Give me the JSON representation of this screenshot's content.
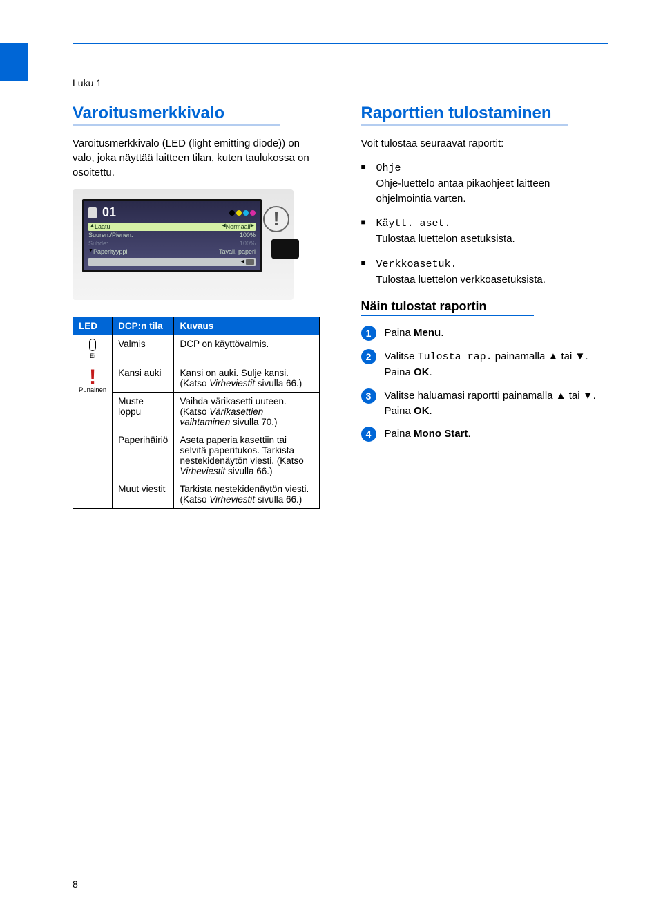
{
  "chapter_label": "Luku 1",
  "page_number": "8",
  "left": {
    "heading": "Varoitusmerkkivalo",
    "intro": "Varoitusmerkkivalo (LED (light emitting diode)) on valo, joka näyttää laitteen tilan, kuten taulukossa on osoitettu.",
    "lcd": {
      "num": "01",
      "rows": [
        {
          "l": "Laatu",
          "r": "Normaali"
        },
        {
          "l": "Suuren./Pienen.",
          "r": "100%"
        },
        {
          "l": "Suhde:",
          "r": "100%"
        },
        {
          "l": "Paperityyppi",
          "r": "Tavall. paperi"
        }
      ]
    },
    "table": {
      "headers": [
        "LED",
        "DCP:n tila",
        "Kuvaus"
      ],
      "led_off_caption": "Ei",
      "led_on_caption": "Punainen",
      "rows": [
        {
          "state": "Valmis",
          "desc": "DCP on käyttövalmis."
        },
        {
          "state": "Kansi auki",
          "desc_pre": "Kansi on auki. Sulje kansi. (Katso ",
          "desc_it": "Virheviestit",
          "desc_post": " sivulla 66.)"
        },
        {
          "state": "Muste loppu",
          "desc_pre": "Vaihda värikasetti uuteen.\n(Katso ",
          "desc_it": "Värikasettien vaihtaminen",
          "desc_post": " sivulla 70.)"
        },
        {
          "state": "Paperihäiriö",
          "desc_pre": "Aseta paperia kasettiin tai selvitä paperitukos. Tarkista nestekidenäytön viesti. (Katso ",
          "desc_it": "Virheviestit",
          "desc_post": " sivulla 66.)"
        },
        {
          "state": "Muut viestit",
          "desc_pre": "Tarkista nestekidenäytön viesti. (Katso ",
          "desc_it": "Virheviestit",
          "desc_post": " sivulla 66.)"
        }
      ]
    }
  },
  "right": {
    "heading": "Raporttien tulostaminen",
    "intro": "Voit tulostaa seuraavat raportit:",
    "bullets": [
      {
        "mono": "Ohje",
        "plain": "Ohje-luettelo antaa pikaohjeet laitteen ohjelmointia varten."
      },
      {
        "mono": "Käytt. aset.",
        "plain": "Tulostaa luettelon asetuksista."
      },
      {
        "mono": "Verkkoasetuk.",
        "plain": "Tulostaa luettelon verkkoasetuksista."
      }
    ],
    "sub_heading": "Näin tulostat raportin",
    "steps": {
      "s1_pre": "Paina ",
      "s1_b": "Menu",
      "s2_pre": "Valitse ",
      "s2_mono": "Tulosta rap.",
      "s2_mid": " painamalla ",
      "s2_arrows": "▲ tai ▼",
      "s2_post": ".",
      "s2_line2_pre": "Paina ",
      "s2_line2_b": "OK",
      "s3_line1": "Valitse haluamasi raportti painamalla ",
      "s3_arrows": "▲ tai ▼",
      "s3_post": ".",
      "s3_line2_pre": "Paina ",
      "s3_line2_b": "OK",
      "s4_pre": "Paina ",
      "s4_b": "Mono Start"
    }
  }
}
